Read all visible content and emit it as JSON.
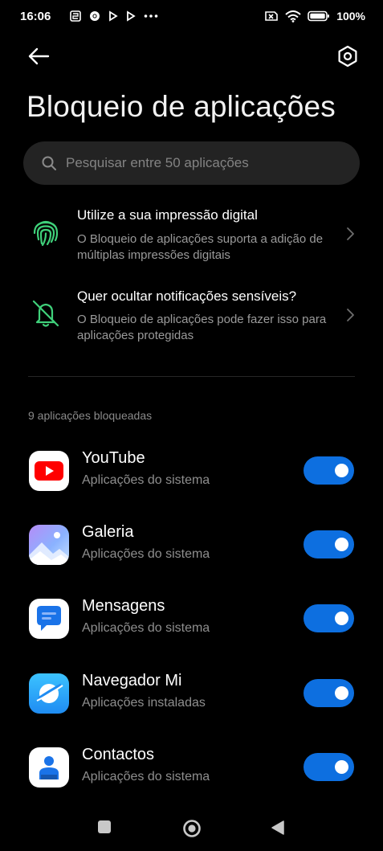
{
  "status_bar": {
    "time": "16:06",
    "battery": "100%",
    "left_icons": [
      "notification-icon",
      "chrome-icon",
      "play-icon",
      "play-icon",
      "more-dots-icon"
    ],
    "right_icons": [
      "sim-off-icon",
      "wifi-icon",
      "battery-icon"
    ]
  },
  "header": {
    "title": "Bloqueio de aplicações"
  },
  "search": {
    "placeholder": "Pesquisar entre 50 aplicações"
  },
  "info_rows": [
    {
      "title": "Utilize a sua impressão digital",
      "description": "O Bloqueio de aplicações suporta a adição de múltiplas impressões digitais",
      "icon": "fingerprint-icon"
    },
    {
      "title": "Quer ocultar notificações sensíveis?",
      "description": "O Bloqueio de aplicações pode fazer isso para aplicações protegidas",
      "icon": "bell-off-icon"
    }
  ],
  "section": {
    "label": "9 aplicações bloqueadas"
  },
  "apps": [
    {
      "name": "YouTube",
      "category": "Aplicações do sistema",
      "icon": "youtube-icon",
      "enabled": true
    },
    {
      "name": "Galeria",
      "category": "Aplicações do sistema",
      "icon": "gallery-icon",
      "enabled": true
    },
    {
      "name": "Mensagens",
      "category": "Aplicações do sistema",
      "icon": "messages-icon",
      "enabled": true
    },
    {
      "name": "Navegador Mi",
      "category": "Aplicações instaladas",
      "icon": "mi-browser-icon",
      "enabled": true
    },
    {
      "name": "Contactos",
      "category": "Aplicações do sistema",
      "icon": "contacts-icon",
      "enabled": true
    }
  ],
  "colors": {
    "background": "#000000",
    "accent": "#0d6fe0",
    "info_icon": "#3fd07a",
    "secondary_text": "#9a9a9a"
  }
}
